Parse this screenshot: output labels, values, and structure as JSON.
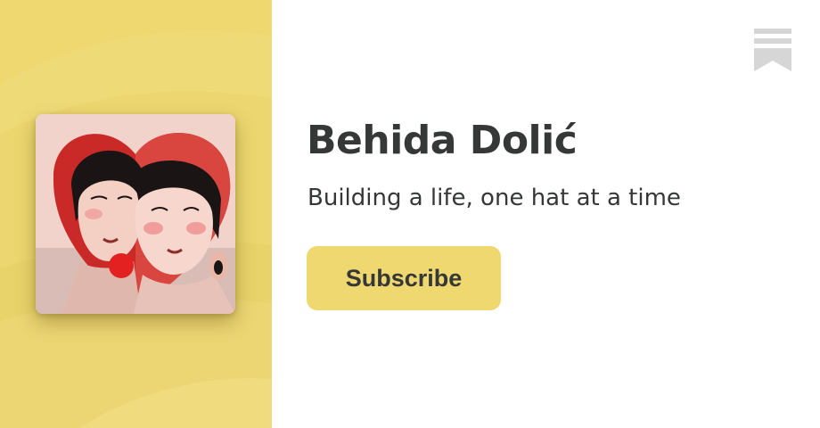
{
  "profile": {
    "name": "Behida Dolić",
    "tagline": "Building a life, one hat at a time",
    "avatar_icon": "illustrated-portrait-two-women"
  },
  "actions": {
    "subscribe_label": "Subscribe"
  },
  "brand": {
    "logo_icon": "substack-bookmark-icon"
  },
  "colors": {
    "accent": "#efd870",
    "text": "#363737",
    "logo": "#d6d6d6",
    "background": "#ffffff"
  }
}
